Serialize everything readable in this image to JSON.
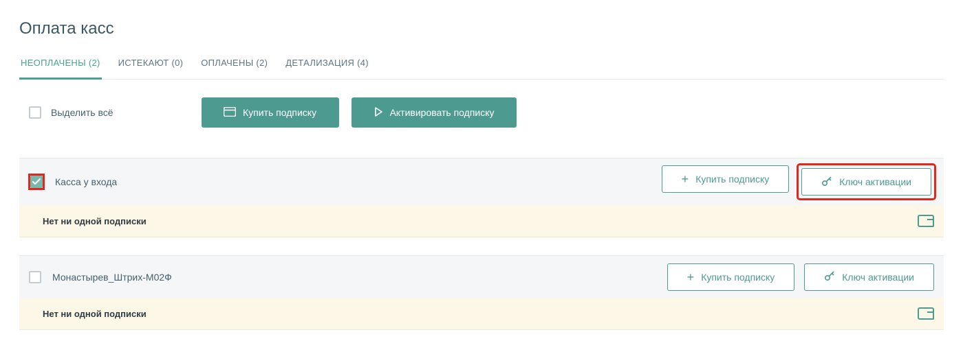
{
  "colors": {
    "accent": "#4d9a91",
    "title": "#3b5766",
    "highlight": "#e1261c",
    "row_bg": "#f4f6f7",
    "warn_bg": "#fcf7e6"
  },
  "title": "Оплата касс",
  "tabs": [
    {
      "label": "НЕОПЛАЧЕНЫ (2)",
      "active": true
    },
    {
      "label": "ИСТЕКАЮТ (0)",
      "active": false
    },
    {
      "label": "ОПЛАЧЕНЫ (2)",
      "active": false
    },
    {
      "label": "ДЕТАЛИЗАЦИЯ (4)",
      "active": false
    }
  ],
  "toolbar": {
    "select_all_label": "Выделить всё",
    "select_all_checked": false,
    "buy_label": "Купить подписку",
    "activate_label": "Активировать подписку"
  },
  "row_actions": {
    "buy_label": "Купить подписку",
    "key_label": "Ключ активации"
  },
  "no_sub_msg": "Нет ни одной подписки",
  "rows": [
    {
      "name": "Касса у входа",
      "checked": true,
      "highlight_checkbox": true,
      "highlight_key": true
    },
    {
      "name": "Монастырев_Штрих-М02Ф",
      "checked": false,
      "highlight_checkbox": false,
      "highlight_key": false
    }
  ]
}
